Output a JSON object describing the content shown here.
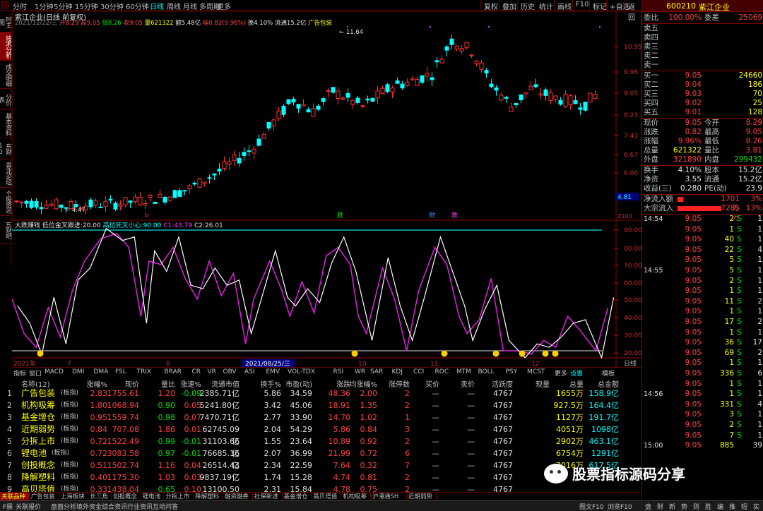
{
  "topbar": {
    "periods": [
      "分时",
      "1分钟",
      "5分钟",
      "15分钟",
      "30分钟",
      "60分钟",
      "日线",
      "周线",
      "月线",
      "多周期",
      "更多"
    ],
    "active": "日线",
    "right": [
      "复权",
      "叠加",
      "历史",
      "统计",
      "画线",
      "F10",
      "标记",
      "+自选",
      "返回"
    ]
  },
  "leftnav": [
    "时主图",
    "技术分析",
    "成交明细",
    "分价表",
    "基本资料",
    "东财10",
    "景北论坛",
    "个股资讯",
    "东财吧"
  ],
  "info": {
    "name": "紫江企业",
    "period": "(日线 前复权)",
    "date": "2021/12/22/三",
    "open": "开8.29",
    "high": "高9.05",
    "low": "低8.26",
    "close": "收9.05",
    "vol": "量621322",
    "amt": "额5.48亿",
    "chg": "幅0.82(9.96%)",
    "turn": "换4.10%",
    "float": "流通15.2亿",
    "concept": "广告包装"
  },
  "yaxis": [
    "10.95",
    "9.96",
    "9.05",
    "8.23",
    "7.41",
    "6.67",
    "6.00"
  ],
  "price_hi": "11.64",
  "price_lo": "4.47",
  "cur_price": "4.81",
  "x100": "X100",
  "markers": [
    "b",
    "跌",
    "财",
    "跌"
  ],
  "ind": {
    "name": "大跌赚钱",
    "v1label": "低位金叉跟进:",
    "v1": "20.00",
    "v2label": "高位死叉小心:",
    "v2": "90.00",
    "c1label": "C1:",
    "c1": "43.79",
    "c2label": "C2:",
    "c2": "26.01"
  },
  "ind_y": [
    "90.00",
    "80.00",
    "70.00",
    "60.00",
    "50.00",
    "40.00",
    "30.00",
    "20.00"
  ],
  "xaxis": [
    "2021年",
    "7",
    "8",
    "2021/08/25/三",
    "10",
    "11",
    "12",
    "日线"
  ],
  "tabbar": [
    "指标",
    "窗口",
    "MACD",
    "DMI",
    "DMA",
    "FSL",
    "TRIX",
    "BRAR",
    "CR",
    "VR",
    "OBV",
    "ASI",
    "EMV",
    "VOL-TDX",
    "RSI",
    "WR",
    "SAR",
    "KDJ",
    "CCI",
    "ROC",
    "MTM",
    "BOLL",
    "PSY",
    "MCST",
    "更多",
    "设置",
    "模板"
  ],
  "table": {
    "headers": [
      "名称(12)",
      "涨幅%",
      "现价",
      "量比",
      "涨速%",
      "流通市值",
      "换手%",
      "市盈(动)",
      "涨跌",
      "均涨幅%",
      "涨停数",
      "买价",
      "卖价",
      "活跃度",
      "现量",
      "总量",
      "总金额"
    ],
    "rows": [
      {
        "n": "1",
        "name": "广告包装",
        "tag": "(板指)",
        "chg": "2.83",
        "price": "1755.61",
        "lb": "1.20",
        "spd": "-0.09",
        "mv": "2385.71亿",
        "turn": "5.86",
        "pe": "34.59",
        "up": "48.36",
        "avg": "2.00",
        "lim": "2",
        "buy": "—",
        "sell": "—",
        "act": "4767",
        "cur": "",
        "vol": "1655万",
        "amt": "158.9亿"
      },
      {
        "n": "2",
        "name": "机构吸筹",
        "tag": "(板指)",
        "chg": "1.80",
        "price": "1068.94",
        "lb": "0.90",
        "spd": "0.05",
        "mv": "5241.80亿",
        "turn": "3.42",
        "pe": "45.06",
        "up": "18.91",
        "avg": "1.35",
        "lim": "2",
        "buy": "—",
        "sell": "—",
        "act": "4767",
        "cur": "",
        "vol": "927.5万",
        "amt": "164.4亿"
      },
      {
        "n": "3",
        "name": "基金增仓",
        "tag": "(板指)",
        "chg": "0.95",
        "price": "1559.74",
        "lb": "0.98",
        "spd": "0.07",
        "mv": "7470.71亿",
        "turn": "2.77",
        "pe": "33.90",
        "up": "14.70",
        "avg": "1.02",
        "lim": "1",
        "buy": "—",
        "sell": "—",
        "act": "4767",
        "cur": "",
        "vol": "1127万",
        "amt": "191.7亿"
      },
      {
        "n": "4",
        "name": "近期弱势",
        "tag": "(板指)",
        "chg": "0.84",
        "price": "707.08",
        "lb": "1.86",
        "spd": "0.01",
        "mv": "62745.09亿",
        "turn": "2.04",
        "pe": "54.29",
        "up": "5.86",
        "avg": "0.84",
        "lim": "3",
        "buy": "—",
        "sell": "—",
        "act": "4767",
        "cur": "",
        "vol": "4051万",
        "amt": "1098亿"
      },
      {
        "n": "5",
        "name": "分拆上市",
        "tag": "(板指)",
        "chg": "0.72",
        "price": "1522.49",
        "lb": "0.99",
        "spd": "-0.01",
        "mv": "31103.66亿",
        "turn": "1.55",
        "pe": "23.64",
        "up": "10.89",
        "avg": "0.92",
        "lim": "2",
        "buy": "—",
        "sell": "—",
        "act": "4767",
        "cur": "",
        "vol": "2902万",
        "amt": "463.1亿"
      },
      {
        "n": "6",
        "name": "锂电池",
        "tag": "(板指)",
        "chg": "0.72",
        "price": "3083.58",
        "lb": "0.97",
        "spd": "-0.01",
        "mv": "76685.16亿",
        "turn": "2.07",
        "pe": "36.99",
        "up": "21.99",
        "avg": "0.72",
        "lim": "6",
        "buy": "—",
        "sell": "—",
        "act": "4767",
        "cur": "",
        "vol": "6754万",
        "amt": "1291亿"
      },
      {
        "n": "7",
        "name": "创投概念",
        "tag": "(板指)",
        "chg": "0.51",
        "price": "1502.74",
        "lb": "1.16",
        "spd": "0.04",
        "mv": "26514.43亿",
        "turn": "2.34",
        "pe": "22.59",
        "up": "7.64",
        "avg": "0.32",
        "lim": "7",
        "buy": "—",
        "sell": "—",
        "act": "4767",
        "cur": "",
        "vol": "7016万",
        "amt": "617.5亿"
      },
      {
        "n": "8",
        "name": "降解塑料",
        "tag": "(板指)",
        "chg": "0.40",
        "price": "1175.30",
        "lb": "1.03",
        "spd": "0.03",
        "mv": "9837.19亿",
        "turn": "1.74",
        "pe": "15.28",
        "up": "4.74",
        "avg": "0.81",
        "lim": "2",
        "buy": "—",
        "sell": "—",
        "act": "4767",
        "cur": "",
        "vol": "",
        "amt": ""
      },
      {
        "n": "9",
        "name": "高贝塔值",
        "tag": "(板指)",
        "chg": "0.33",
        "price": "1438.04",
        "lb": "0.65",
        "spd": "0.10",
        "mv": "13100.50亿",
        "turn": "2.31",
        "pe": "15.84",
        "up": "4.78",
        "avg": "0.75",
        "lim": "2",
        "buy": "—",
        "sell": "—",
        "act": "4767",
        "cur": "",
        "vol": "",
        "amt": ""
      }
    ]
  },
  "bottomtabs": [
    "关联品种",
    "广告包装",
    "上海板块",
    "长三角",
    "创投概念",
    "锂电池",
    "分拆上市",
    "降解塑料",
    "融资融券",
    "社保新进",
    "基金增仓",
    "高贝塔值",
    "机构吸筹",
    "沪港通SH",
    "近期弱势"
  ],
  "statusbar": [
    "F展",
    "关联报价",
    "盘面分析",
    "境外资金",
    "综合资讯",
    "行业资讯",
    "互动问答",
    "图文F10",
    "浏览F10"
  ],
  "right": {
    "code": "600210",
    "name": "紫江企业",
    "wb": "委比",
    "wbv": "100.00%",
    "wc": "委差",
    "wcv": "25069",
    "sell": [
      "卖五",
      "卖四",
      "卖三",
      "卖二",
      "卖一"
    ],
    "buy": [
      {
        "l": "买一",
        "p": "9.05",
        "v": "24660"
      },
      {
        "l": "买二",
        "p": "9.04",
        "v": "186"
      },
      {
        "l": "买三",
        "p": "9.03",
        "v": "70"
      },
      {
        "l": "买四",
        "p": "9.02",
        "v": "25"
      },
      {
        "l": "买五",
        "p": "9.01",
        "v": "128"
      }
    ],
    "stats": [
      [
        "现价",
        "9.05",
        "今开",
        "8.29"
      ],
      [
        "涨跌",
        "0.82",
        "最高",
        "9.05"
      ],
      [
        "涨幅",
        "9.96%",
        "最低",
        "8.26"
      ],
      [
        "总量",
        "621322",
        "量比",
        "3.81"
      ],
      [
        "外盘",
        "321890",
        "内盘",
        "299432"
      ],
      [
        "换手",
        "4.10%",
        "股本",
        "15.2亿"
      ],
      [
        "净资",
        "3.55",
        "流通",
        "15.2亿"
      ],
      [
        "收益(三)",
        "0.280",
        "PE(动)",
        "23.9"
      ]
    ],
    "flow": [
      {
        "l": "净流入额",
        "v": "1701万",
        "p": "3%"
      },
      {
        "l": "大宗流入",
        "v": "7285万",
        "p": "13%"
      }
    ],
    "ticks": [
      {
        "t": "14:54",
        "p": "9.05",
        "v": "2",
        "d": "S",
        "c": "1"
      },
      {
        "t": "",
        "p": "9.05",
        "v": "1",
        "d": "S",
        "c": "1"
      },
      {
        "t": "",
        "p": "9.05",
        "v": "40",
        "d": "S",
        "c": "1"
      },
      {
        "t": "",
        "p": "9.05",
        "v": "22",
        "d": "S",
        "c": "4"
      },
      {
        "t": "",
        "p": "9.05",
        "v": "5",
        "d": "S",
        "c": "1"
      },
      {
        "t": "14:55",
        "p": "9.05",
        "v": "5",
        "d": "S",
        "c": "1"
      },
      {
        "t": "",
        "p": "9.05",
        "v": "2",
        "d": "S",
        "c": "1"
      },
      {
        "t": "",
        "p": "9.05",
        "v": "1",
        "d": "S",
        "c": "1"
      },
      {
        "t": "",
        "p": "9.05",
        "v": "11",
        "d": "S",
        "c": "2"
      },
      {
        "t": "",
        "p": "9.05",
        "v": "1",
        "d": "S",
        "c": "1"
      },
      {
        "t": "",
        "p": "9.05",
        "v": "17",
        "d": "S",
        "c": "2"
      },
      {
        "t": "",
        "p": "9.05",
        "v": "1",
        "d": "S",
        "c": "1"
      },
      {
        "t": "",
        "p": "9.05",
        "v": "36",
        "d": "S",
        "c": "17"
      },
      {
        "t": "",
        "p": "9.05",
        "v": "69",
        "d": "S",
        "c": "2"
      },
      {
        "t": "",
        "p": "9.05",
        "v": "1",
        "d": "S",
        "c": "1"
      },
      {
        "t": "",
        "p": "9.05",
        "v": "336",
        "d": "S",
        "c": "6"
      },
      {
        "t": "",
        "p": "9.05",
        "v": "1",
        "d": "S",
        "c": "1"
      },
      {
        "t": "14:56",
        "p": "9.05",
        "v": "1",
        "d": "S",
        "c": "1"
      },
      {
        "t": "",
        "p": "9.05",
        "v": "331",
        "d": "S",
        "c": "4"
      },
      {
        "t": "",
        "p": "9.05",
        "v": "3",
        "d": "S",
        "c": "1"
      },
      {
        "t": "",
        "p": "9.05",
        "v": "2",
        "d": "S",
        "c": "1"
      },
      {
        "t": "",
        "p": "9.05",
        "v": "7",
        "d": "S",
        "c": "1"
      },
      {
        "t": "15:00",
        "p": "9.05",
        "v": "885",
        "d": "",
        "c": "39"
      }
    ],
    "bottom": [
      "盘",
      "财",
      "新",
      "势",
      "则",
      "胜",
      "编",
      "推",
      "短",
      "实"
    ]
  },
  "watermark": "股票指标源码分享"
}
